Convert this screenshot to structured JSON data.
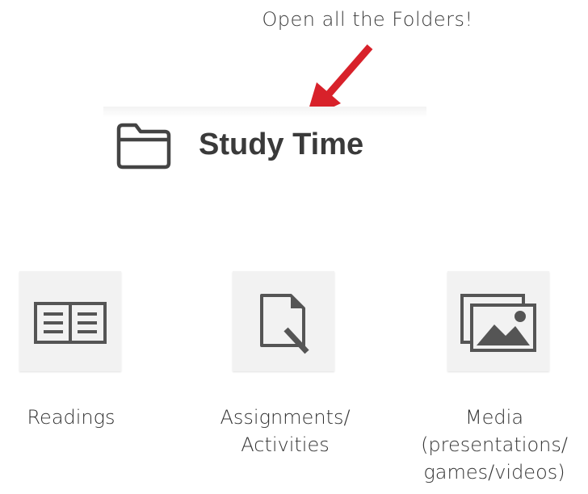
{
  "callout": {
    "text": "Open all the Folders!"
  },
  "folder": {
    "title": "Study Time",
    "icon": "folder-icon"
  },
  "tiles": [
    {
      "icon": "book-icon",
      "label_lines": [
        "Readings"
      ]
    },
    {
      "icon": "document-edit-icon",
      "label_lines": [
        "Assignments/",
        "Activities"
      ]
    },
    {
      "icon": "image-gallery-icon",
      "label_lines": [
        "Media",
        "(presentations/",
        "games/videos)"
      ]
    }
  ],
  "colors": {
    "arrow": "#d8212a",
    "icon_stroke": "#555555",
    "tile_bg": "#f2f2f2"
  }
}
